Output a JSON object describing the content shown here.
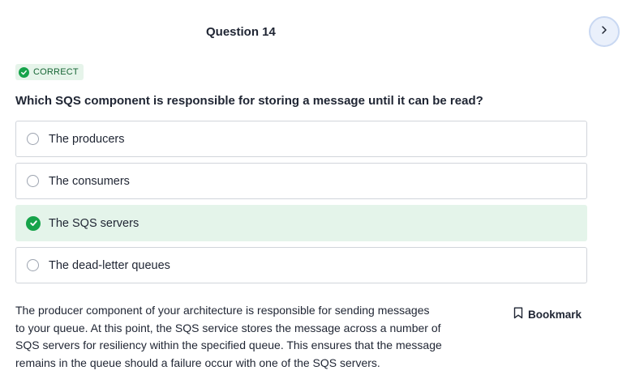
{
  "header": {
    "question_title": "Question 14",
    "next_icon": "chevron-right-icon"
  },
  "status": {
    "label": "CORRECT",
    "icon": "check-circle-icon",
    "color": "#16a34a"
  },
  "question": {
    "text": "Which SQS component is responsible for storing a message until it can be read?",
    "options": [
      {
        "label": "The producers",
        "correct": false
      },
      {
        "label": "The consumers",
        "correct": false
      },
      {
        "label": "The SQS servers",
        "correct": true
      },
      {
        "label": "The dead-letter queues",
        "correct": false
      }
    ]
  },
  "explanation": {
    "lines": [
      "The producer component of your architecture is responsible for sending messages",
      "to your queue. At this point, the SQS service stores the message across a number of",
      "SQS servers for resiliency within the specified queue. This ensures that the message",
      "remains in the queue should a failure occur with one of the SQS servers."
    ]
  },
  "bookmark": {
    "label": "Bookmark",
    "icon": "bookmark-icon"
  },
  "colors": {
    "correct_bg": "#e4f4ea",
    "accent_green": "#16a34a",
    "next_bg": "#eaf0fb"
  }
}
